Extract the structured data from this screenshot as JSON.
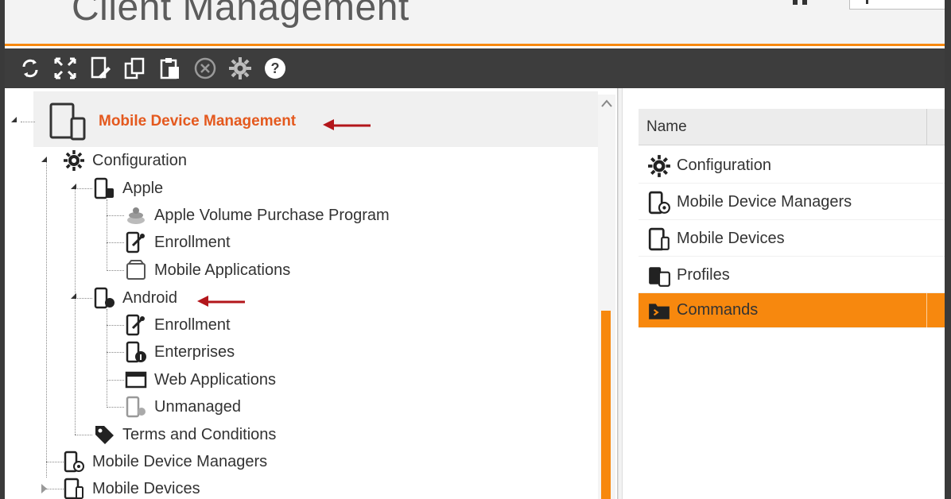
{
  "header": {
    "title": "Client Management"
  },
  "toolbar": {
    "buttons": [
      {
        "name": "refresh-icon"
      },
      {
        "name": "expand-icon"
      },
      {
        "name": "edit-icon"
      },
      {
        "name": "copy-icon"
      },
      {
        "name": "paste-icon"
      },
      {
        "name": "delete-icon"
      },
      {
        "name": "gear-icon"
      },
      {
        "name": "help-icon"
      }
    ]
  },
  "tree": {
    "root": {
      "label": "Mobile Device Management",
      "icon": "mobile-device-icon"
    },
    "configuration": {
      "label": "Configuration",
      "icon": "gear-icon"
    },
    "apple": {
      "label": "Apple",
      "icon": "apple-device-icon"
    },
    "apple_vpp": {
      "label": "Apple Volume Purchase Program",
      "icon": "vpp-icon"
    },
    "apple_enrollment": {
      "label": "Enrollment",
      "icon": "enrollment-icon"
    },
    "apple_mobile_apps": {
      "label": "Mobile Applications",
      "icon": "mobile-apps-icon"
    },
    "android": {
      "label": "Android",
      "icon": "android-device-icon"
    },
    "android_enrollment": {
      "label": "Enrollment",
      "icon": "enrollment-icon"
    },
    "android_enterprises": {
      "label": "Enterprises",
      "icon": "enterprise-icon"
    },
    "android_web_apps": {
      "label": "Web Applications",
      "icon": "web-app-icon"
    },
    "android_unmanaged": {
      "label": "Unmanaged",
      "icon": "unmanaged-icon"
    },
    "terms": {
      "label": "Terms and Conditions",
      "icon": "tag-icon"
    },
    "mdm_managers": {
      "label": "Mobile Device Managers",
      "icon": "device-manager-icon"
    },
    "mobile_devices": {
      "label": "Mobile Devices",
      "icon": "mobile-devices-icon"
    }
  },
  "list": {
    "column_name": "Name",
    "rows": [
      {
        "label": "Configuration",
        "icon": "gear-icon",
        "selected": false
      },
      {
        "label": "Mobile Device Managers",
        "icon": "device-manager-icon",
        "selected": false
      },
      {
        "label": "Mobile Devices",
        "icon": "mobile-devices-icon",
        "selected": false
      },
      {
        "label": "Profiles",
        "icon": "profiles-icon",
        "selected": false
      },
      {
        "label": "Commands",
        "icon": "commands-icon",
        "selected": true
      }
    ]
  },
  "colors": {
    "accent": "#f7880e",
    "root_label": "#e4591e",
    "toolbar_bg": "#3d3d3d",
    "arrow": "#b3161b"
  }
}
